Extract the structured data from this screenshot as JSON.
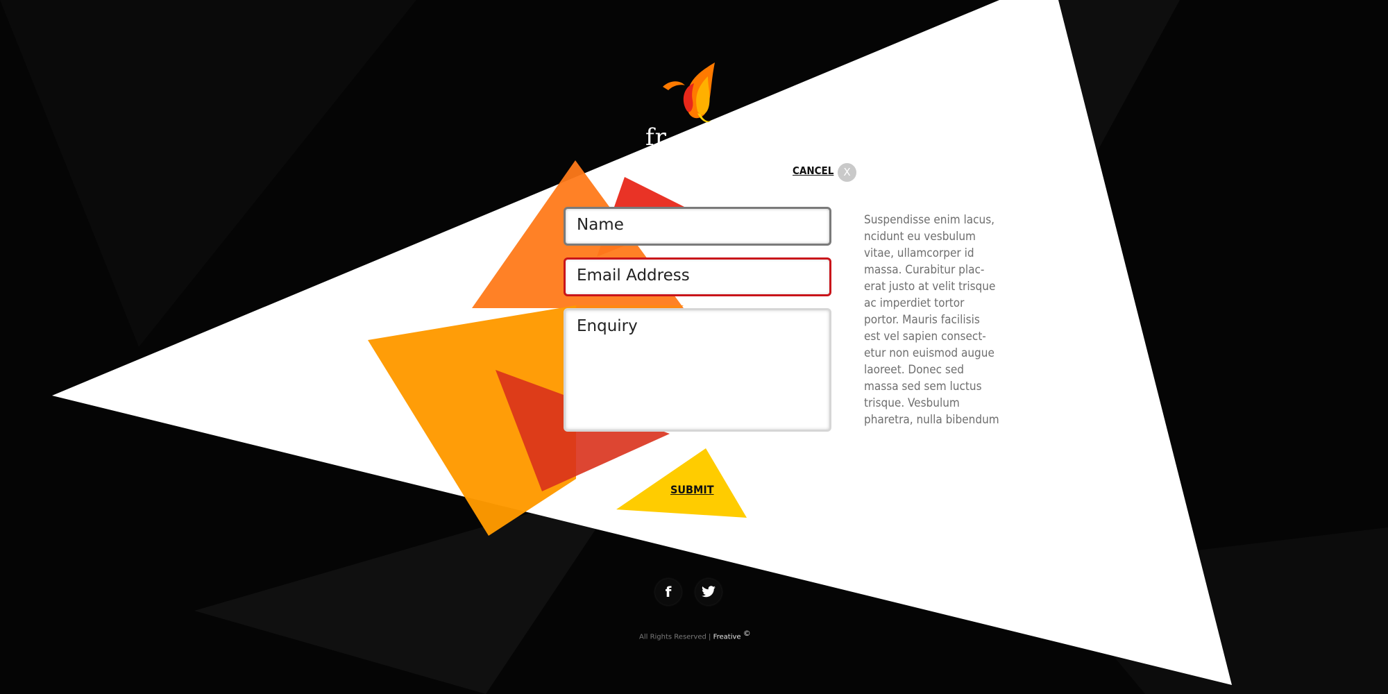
{
  "brand": {
    "logo_text": "fr",
    "logo_icon": "phoenix-flame-icon"
  },
  "form": {
    "cancel_label": "CANCEL",
    "close_label": "X",
    "name_placeholder": "Name",
    "email_placeholder": "Email Address",
    "enquiry_placeholder": "Enquiry",
    "submit_label": "SUBMIT"
  },
  "side_text": "Suspendisse enim lacus,\nncidunt eu vesbulum\nvitae, ullamcorper id\nmassa. Curabitur plac-\nerat justo at velit  trisque\nac imperdiet tortor\nportor. Mauris facilisis\nest vel sapien consect-\netur non euismod augue\nlaoreet. Donec sed\nmassa sed sem luctus\ntrisque. Vesbulum\npharetra, nulla bibendum",
  "social": [
    {
      "icon": "facebook-icon",
      "glyph": "f"
    },
    {
      "icon": "twitter-icon"
    }
  ],
  "footer": {
    "rights": "All Rights Reserved | ",
    "brand": "Freative",
    "copyright": "©"
  },
  "colors": {
    "background": "#050505",
    "panel": "#ffffff",
    "orange": "#ff7a1a",
    "amber": "#ff9a00",
    "red": "#e8281a",
    "yellow": "#ffcc00",
    "error_border": "#c9141a"
  }
}
